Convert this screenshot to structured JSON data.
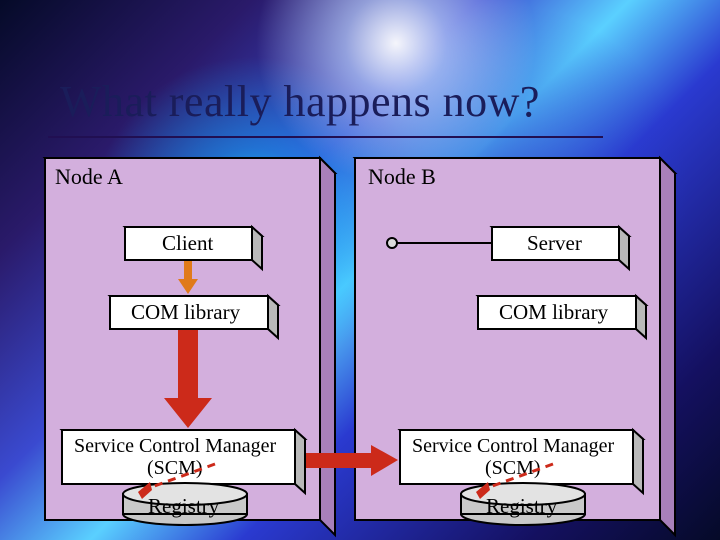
{
  "title": "What really happens now?",
  "nodeA": {
    "label": "Node A",
    "client": "Client",
    "com": "COM library",
    "scm1": "Service Control Manager",
    "scm2": "(SCM)",
    "registry": "Registry"
  },
  "nodeB": {
    "label": "Node B",
    "server": "Server",
    "com": "COM library",
    "scm1": "Service Control Manager",
    "scm2": "(SCM)",
    "registry": "Registry"
  }
}
